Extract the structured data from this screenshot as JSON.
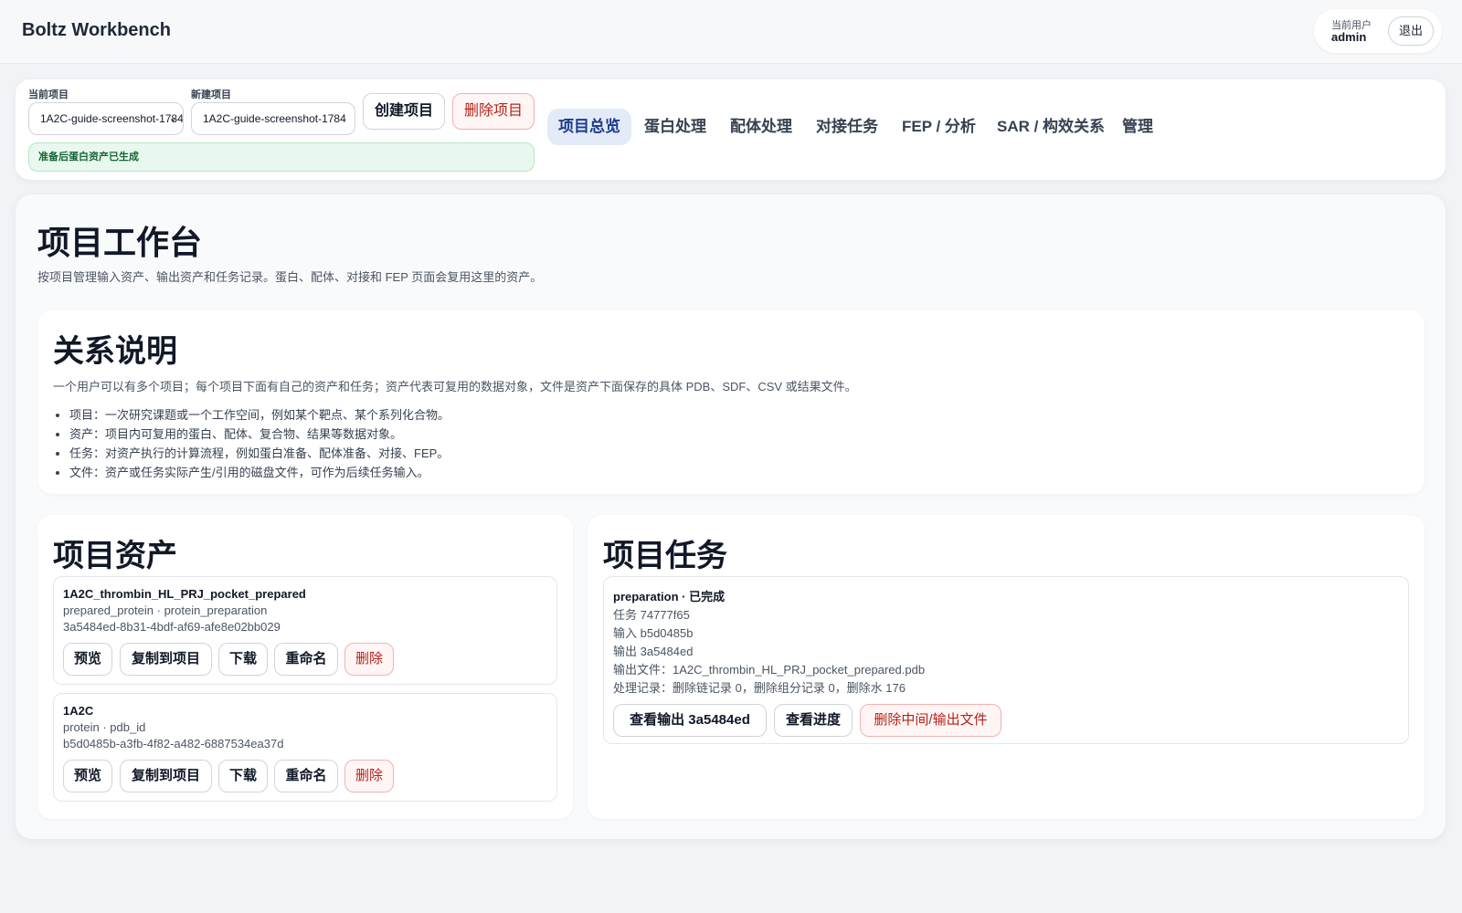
{
  "app": {
    "title": "Boltz Workbench"
  },
  "user": {
    "label": "当前用户",
    "name": "admin",
    "logout_label": "退出"
  },
  "toolbar": {
    "current_project_label": "当前项目",
    "current_project_value": "1A2C-guide-screenshot-1784",
    "new_project_label": "新建项目",
    "new_project_value": "1A2C-guide-screenshot-1784",
    "create_label": "创建项目",
    "delete_label": "删除项目",
    "status_text": "准备后蛋白资产已生成"
  },
  "tabs": [
    {
      "label": "项目总览",
      "active": true
    },
    {
      "label": "蛋白处理"
    },
    {
      "label": "配体处理"
    },
    {
      "label": "对接任务"
    },
    {
      "label": "FEP / 分析"
    },
    {
      "label": "SAR / 构效关系"
    },
    {
      "label": "管理"
    }
  ],
  "main": {
    "title": "项目工作台",
    "subtitle": "按项目管理输入资产、输出资产和任务记录。蛋白、配体、对接和 FEP 页面会复用这里的资产。"
  },
  "relations": {
    "title": "关系说明",
    "description": "一个用户可以有多个项目；每个项目下面有自己的资产和任务；资产代表可复用的数据对象，文件是资产下面保存的具体 PDB、SDF、CSV 或结果文件。",
    "items": [
      "项目：一次研究课题或一个工作空间，例如某个靶点、某个系列化合物。",
      "资产：项目内可复用的蛋白、配体、复合物、结果等数据对象。",
      "任务：对资产执行的计算流程，例如蛋白准备、配体准备、对接、FEP。",
      "文件：资产或任务实际产生/引用的磁盘文件，可作为后续任务输入。"
    ]
  },
  "assets": {
    "title": "项目资产",
    "items": [
      {
        "name": "1A2C_thrombin_HL_PRJ_pocket_prepared",
        "type": "prepared_protein · protein_preparation",
        "id": "3a5484ed-8b31-4bdf-af69-afe8e02bb029"
      },
      {
        "name": "1A2C",
        "type": "protein · pdb_id",
        "id": "b5d0485b-a3fb-4f82-a482-6887534ea37d"
      }
    ],
    "actions": {
      "preview": "预览",
      "copy": "复制到项目",
      "download": "下载",
      "rename": "重命名",
      "delete": "删除"
    }
  },
  "tasks": {
    "title": "项目任务",
    "items": [
      {
        "header": "preparation · 已完成",
        "task_id": "任务 74777f65",
        "input": "输入 b5d0485b",
        "output": "输出 3a5484ed",
        "output_file": "输出文件：1A2C_thrombin_HL_PRJ_pocket_prepared.pdb",
        "log": "处理记录：删除链记录 0，删除组分记录 0，删除水 176",
        "view_output_label": "查看输出 3a5484ed",
        "view_progress_label": "查看进度",
        "delete_files_label": "删除中间/输出文件"
      }
    ]
  },
  "colors": {
    "background": "#f1f3f7",
    "tab_active_bg": "#e3ebf8",
    "danger": "#b42318",
    "success_bg": "#e9f8ef",
    "success_text": "#166534"
  }
}
